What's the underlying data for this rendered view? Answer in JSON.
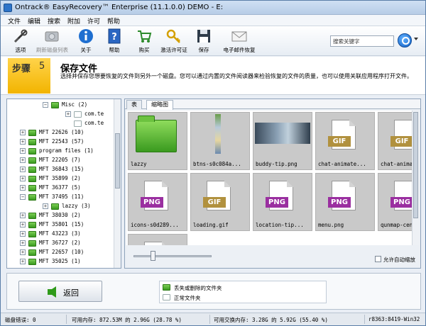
{
  "window": {
    "title": "Ontrack® EasyRecovery™ Enterprise (11.1.0.0) DEMO - E:"
  },
  "menu": [
    "文件",
    "编辑",
    "搜索",
    "附加",
    "许可",
    "帮助"
  ],
  "toolbar": {
    "options": "选项",
    "refresh": "刷新磁盘列表",
    "about": "关于",
    "help": "帮助",
    "buy": "购买",
    "activate": "激活许可证",
    "save": "保存",
    "email": "电子邮件恢复",
    "search_placeholder": "搜索关键字"
  },
  "step": {
    "label": "步骤",
    "number": "5",
    "title": "保存文件",
    "desc": "选择并保存您想要恢复的文件到另外一个磁盘。您可以通过内置的文件阅读器来检验恢复的文件的质量，也可以使用关联应用程序打开文件。"
  },
  "tree": [
    {
      "text": "Misc (2)",
      "indent": 1,
      "expander": "−"
    },
    {
      "text": "com.te",
      "indent": 2,
      "expander": "+",
      "white": true
    },
    {
      "text": "com.te",
      "indent": 2,
      "expander": "",
      "white": true
    },
    {
      "text": "MFT 22626 (10)",
      "indent": 0,
      "expander": "+"
    },
    {
      "text": "MFT 22543 (57)",
      "indent": 0,
      "expander": "+"
    },
    {
      "text": "program files (1)",
      "indent": 0,
      "expander": "+"
    },
    {
      "text": "MFT 22205 (7)",
      "indent": 0,
      "expander": "+"
    },
    {
      "text": "MFT 36843 (15)",
      "indent": 0,
      "expander": "+"
    },
    {
      "text": "MFT 35899 (2)",
      "indent": 0,
      "expander": "+"
    },
    {
      "text": "MFT 36377 (5)",
      "indent": 0,
      "expander": "+"
    },
    {
      "text": "MFT 37495 (11)",
      "indent": 0,
      "expander": "−"
    },
    {
      "text": "lazzy (3)",
      "indent": 1,
      "expander": "+"
    },
    {
      "text": "MFT 38030 (2)",
      "indent": 0,
      "expander": "+"
    },
    {
      "text": "MFT 35801 (15)",
      "indent": 0,
      "expander": "+"
    },
    {
      "text": "MFT 43223 (3)",
      "indent": 0,
      "expander": "+"
    },
    {
      "text": "MFT 36727 (2)",
      "indent": 0,
      "expander": "+"
    },
    {
      "text": "MFT 22657 (10)",
      "indent": 0,
      "expander": "+"
    },
    {
      "text": "MFT 35025 (1)",
      "indent": 0,
      "expander": "+"
    }
  ],
  "tabs": {
    "table": "表",
    "thumbs": "缩略图"
  },
  "grid": [
    {
      "name": "lazzy",
      "kind": "folder"
    },
    {
      "name": "btns-s0c084a...",
      "kind": "strip"
    },
    {
      "name": "buddy-tip.png",
      "kind": "photo"
    },
    {
      "name": "chat-animate...",
      "kind": "gif"
    },
    {
      "name": "chat-animate...",
      "kind": "gif"
    },
    {
      "name": "icons-s0d289...",
      "kind": "png"
    },
    {
      "name": "loading.gif",
      "kind": "gif"
    },
    {
      "name": "location-tip...",
      "kind": "png"
    },
    {
      "name": "menu.png",
      "kind": "png"
    },
    {
      "name": "qunmap-cent...",
      "kind": "png"
    },
    {
      "name": "",
      "kind": "blank"
    }
  ],
  "badges": {
    "gif": "GIF",
    "png": "PNG"
  },
  "autozoom": "允许自动缩放",
  "back": "返回",
  "legend": {
    "deleted": "丢失或删除的文件夹",
    "normal": "正常文件夹"
  },
  "status": {
    "disk_errors": "磁盘错误: 0",
    "memory": "可用内存: 872.53M 的 2.96G (28.78 %)",
    "swap": "可用交换内存: 3.28G 的 5.92G (55.40 %)",
    "build": "r8363:8419-Win32"
  }
}
